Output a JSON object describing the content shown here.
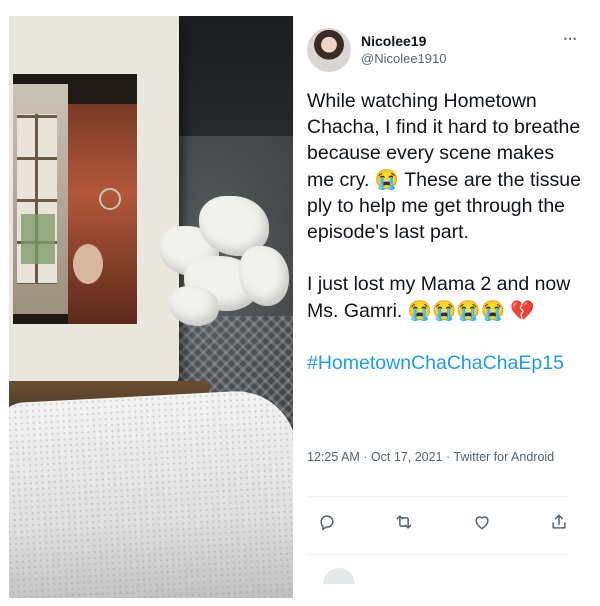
{
  "tweet": {
    "display_name": "Nicolee19",
    "handle": "@Nicolee1910",
    "more_icon": "⋯",
    "text_p1": "While watching Hometown Chacha, I find it hard to breathe because every scene makes me cry. 😭 These are the tissue ply to help me get through the episode's last part.",
    "text_p2": "I just lost my Mama 2 and now Ms. Gamri. 😭😭😭😭 💔",
    "hashtag": "#HometownChaChaChaEp15",
    "timestamp": "12:25 AM · Oct 17, 2021 · Twitter for Android"
  },
  "icons": {
    "reply": "reply-icon",
    "retweet": "retweet-icon",
    "like": "like-icon",
    "share": "share-icon"
  },
  "colors": {
    "link": "#1d9bf0",
    "secondary_text": "#536471",
    "primary_text": "#0f1419"
  }
}
